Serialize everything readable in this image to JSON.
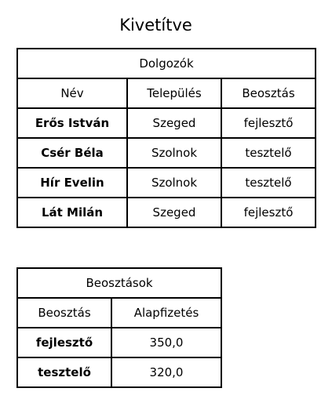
{
  "page": {
    "title": "Kivetítve"
  },
  "employees": {
    "caption": "Dolgozók",
    "headers": [
      "Név",
      "Település",
      "Beosztás"
    ],
    "rows": [
      [
        "Erős István",
        "Szeged",
        "fejlesztő"
      ],
      [
        "Csér Béla",
        "Szolnok",
        "tesztelő"
      ],
      [
        "Hír Evelin",
        "Szolnok",
        "tesztelő"
      ],
      [
        "Lát Milán",
        "Szeged",
        "fejlesztő"
      ]
    ]
  },
  "positions": {
    "caption": "Beosztások",
    "headers": [
      "Beosztás",
      "Alapfizetés"
    ],
    "rows": [
      [
        "fejlesztő",
        "350,0"
      ],
      [
        "tesztelő",
        "320,0"
      ]
    ]
  }
}
